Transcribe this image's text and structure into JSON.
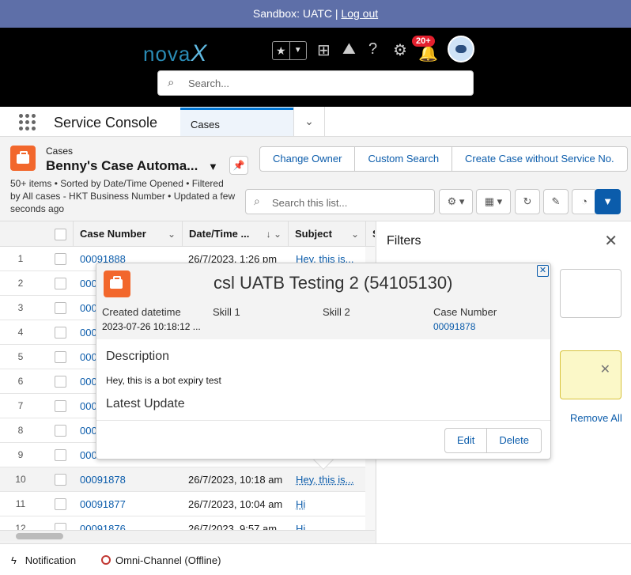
{
  "sandbox": {
    "text": "Sandbox: UATC |",
    "logout": "Log out"
  },
  "header": {
    "logo_main": "nova",
    "logo_x": "X",
    "badge": "20+",
    "search_placeholder": "Search..."
  },
  "nav": {
    "app_name": "Service Console",
    "tab_label": "Cases"
  },
  "list": {
    "object_label": "Cases",
    "title": "Benny's Case Automa...",
    "meta": "50+ items • Sorted by Date/Time Opened • Filtered by All cases - HKT Business Number • Updated a few seconds ago",
    "buttons": [
      "Change Owner",
      "Custom Search",
      "Create Case without Service No."
    ],
    "search_placeholder": "Search this list...",
    "columns": {
      "case_number": "Case Number",
      "date": "Date/Time ...",
      "subject": "Subject",
      "s": "S"
    },
    "rows": [
      {
        "num": "1",
        "case": "00091888",
        "date": "26/7/2023, 1:26 pm",
        "subject": "Hey, this is..."
      },
      {
        "num": "2",
        "case": "000",
        "date": "",
        "subject": ""
      },
      {
        "num": "3",
        "case": "000",
        "date": "",
        "subject": ""
      },
      {
        "num": "4",
        "case": "000",
        "date": "",
        "subject": ""
      },
      {
        "num": "5",
        "case": "000",
        "date": "",
        "subject": ""
      },
      {
        "num": "6",
        "case": "000",
        "date": "",
        "subject": ""
      },
      {
        "num": "7",
        "case": "000",
        "date": "",
        "subject": ""
      },
      {
        "num": "8",
        "case": "000",
        "date": "",
        "subject": ""
      },
      {
        "num": "9",
        "case": "000",
        "date": "",
        "subject": ""
      },
      {
        "num": "10",
        "case": "00091878",
        "date": "26/7/2023, 10:18 am",
        "subject": "Hey, this is..."
      },
      {
        "num": "11",
        "case": "00091877",
        "date": "26/7/2023, 10:04 am",
        "subject": "Hi"
      },
      {
        "num": "12",
        "case": "00091876",
        "date": "26/7/2023, 9:57 am",
        "subject": "Hi"
      }
    ]
  },
  "filters": {
    "title": "Filters",
    "remove_all": "Remove All"
  },
  "popover": {
    "title": "csl UATB Testing 2 (54105130)",
    "fields": [
      {
        "label": "Created datetime",
        "value": "2023-07-26 10:18:12 ..."
      },
      {
        "label": "Skill 1",
        "value": ""
      },
      {
        "label": "Skill 2",
        "value": ""
      },
      {
        "label": "Case Number",
        "value": "00091878"
      }
    ],
    "description_label": "Description",
    "description": "Hey, this is a bot expiry test",
    "latest_update_label": "Latest Update",
    "edit": "Edit",
    "delete": "Delete"
  },
  "footer": {
    "notification": "Notification",
    "omni": "Omni-Channel (Offline)"
  }
}
